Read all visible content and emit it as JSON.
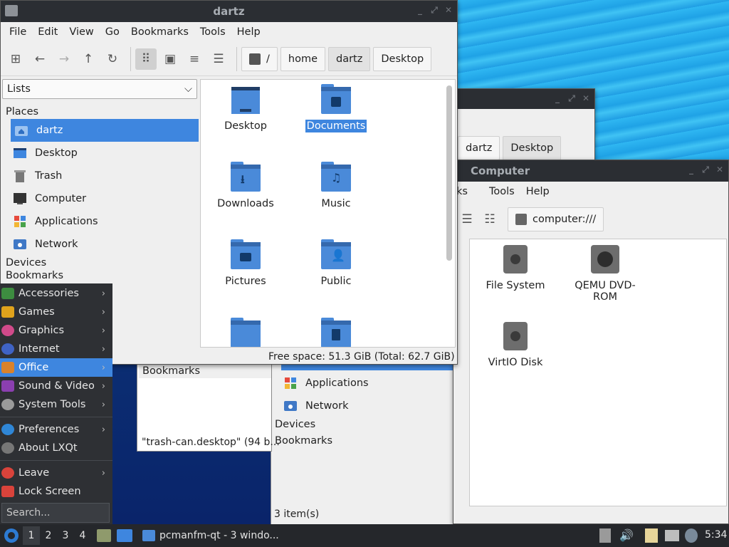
{
  "desktop": {},
  "win_main": {
    "title": "dartz",
    "menu": [
      "File",
      "Edit",
      "View",
      "Go",
      "Bookmarks",
      "Tools",
      "Help"
    ],
    "breadcrumb": [
      "/",
      "home",
      "dartz",
      "Desktop"
    ],
    "side_combo": "Lists",
    "places_label": "Places",
    "places": [
      "dartz",
      "Desktop",
      "Trash",
      "Computer",
      "Applications",
      "Network"
    ],
    "devices_label": "Devices",
    "bookmarks_label": "Bookmarks",
    "files": [
      "Desktop",
      "Documents",
      "Downloads",
      "Music",
      "Pictures",
      "Public"
    ],
    "status": "Free space: 51.3 GiB (Total: 62.7 GiB)"
  },
  "win_back": {
    "breadcrumb": [
      "dartz",
      "Desktop"
    ],
    "places_visible": [
      "Applications",
      "Network"
    ],
    "devices_label": "Devices",
    "bookmarks_label": "Bookmarks",
    "status": "3 item(s)"
  },
  "win_computer": {
    "title": "Computer",
    "menu_partial": "ks",
    "menu": [
      "Tools",
      "Help"
    ],
    "location": "computer:///",
    "items": [
      "File System",
      "QEMU DVD-ROM",
      "VirtIO Disk"
    ]
  },
  "win_trash": {
    "bookmarks_label": "Bookmarks",
    "status": "\"trash-can.desktop\" (94 b..."
  },
  "start_menu": {
    "items": [
      "Accessories",
      "Games",
      "Graphics",
      "Internet",
      "Office",
      "Sound & Video",
      "System Tools"
    ],
    "items2": [
      "Preferences",
      "About LXQt"
    ],
    "items3": [
      "Leave",
      "Lock Screen"
    ],
    "search_placeholder": "Search...",
    "colors": [
      "#3d8c40",
      "#e0a31c",
      "#d04a8a",
      "#3f63c4",
      "#d9822b",
      "#8b3fb0",
      "#9a9a9a"
    ]
  },
  "taskbar": {
    "desktops": [
      "1",
      "2",
      "3",
      "4"
    ],
    "task_label": "pcmanfm-qt - 3 windo...",
    "clock": "5:34"
  }
}
